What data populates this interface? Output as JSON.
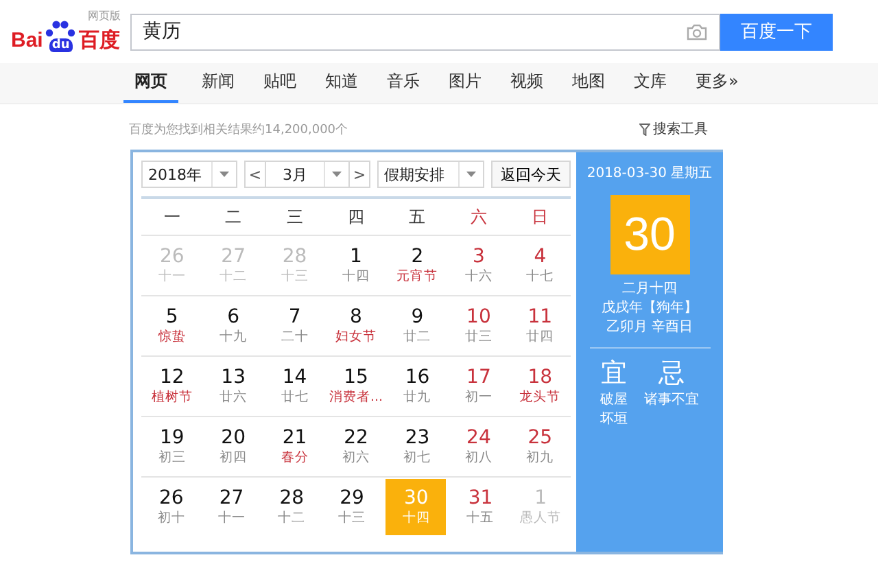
{
  "logo": {
    "left": "Bai",
    "paw": "du",
    "right": "百度",
    "sub": "网页版"
  },
  "search": {
    "value": "黄历",
    "button": "百度一下"
  },
  "tabs": [
    {
      "label": "网页",
      "selected": true
    },
    {
      "label": "新闻",
      "selected": false
    },
    {
      "label": "贴吧",
      "selected": false
    },
    {
      "label": "知道",
      "selected": false
    },
    {
      "label": "音乐",
      "selected": false
    },
    {
      "label": "图片",
      "selected": false
    },
    {
      "label": "视频",
      "selected": false
    },
    {
      "label": "地图",
      "selected": false
    },
    {
      "label": "文库",
      "selected": false
    },
    {
      "label": "更多»",
      "selected": false
    }
  ],
  "result_count": "百度为您找到相关结果约14,200,000个",
  "search_tools": "搜索工具",
  "calendar": {
    "year": "2018年",
    "month_prev": "<",
    "month": "3月",
    "month_next": ">",
    "holiday": "假期安排",
    "today_button": "返回今天",
    "weekdays": [
      {
        "label": "一",
        "weekend": false
      },
      {
        "label": "二",
        "weekend": false
      },
      {
        "label": "三",
        "weekend": false
      },
      {
        "label": "四",
        "weekend": false
      },
      {
        "label": "五",
        "weekend": false
      },
      {
        "label": "六",
        "weekend": true
      },
      {
        "label": "日",
        "weekend": true
      }
    ],
    "weeks": [
      [
        {
          "day": "26",
          "lunar": "十一",
          "kind": "other",
          "selected": false
        },
        {
          "day": "27",
          "lunar": "十二",
          "kind": "other",
          "selected": false
        },
        {
          "day": "28",
          "lunar": "十三",
          "kind": "other",
          "selected": false
        },
        {
          "day": "1",
          "lunar": "十四",
          "kind": "current",
          "weekend": false,
          "festival": false,
          "selected": false
        },
        {
          "day": "2",
          "lunar": "元宵节",
          "kind": "current",
          "weekend": false,
          "festival": true,
          "selected": false
        },
        {
          "day": "3",
          "lunar": "十六",
          "kind": "current",
          "weekend": true,
          "festival": false,
          "selected": false
        },
        {
          "day": "4",
          "lunar": "十七",
          "kind": "current",
          "weekend": true,
          "festival": false,
          "selected": false
        }
      ],
      [
        {
          "day": "5",
          "lunar": "惊蛰",
          "kind": "current",
          "weekend": false,
          "festival": true,
          "selected": false
        },
        {
          "day": "6",
          "lunar": "十九",
          "kind": "current",
          "weekend": false,
          "festival": false,
          "selected": false
        },
        {
          "day": "7",
          "lunar": "二十",
          "kind": "current",
          "weekend": false,
          "festival": false,
          "selected": false
        },
        {
          "day": "8",
          "lunar": "妇女节",
          "kind": "current",
          "weekend": false,
          "festival": true,
          "selected": false
        },
        {
          "day": "9",
          "lunar": "廿二",
          "kind": "current",
          "weekend": false,
          "festival": false,
          "selected": false
        },
        {
          "day": "10",
          "lunar": "廿三",
          "kind": "current",
          "weekend": true,
          "festival": false,
          "selected": false
        },
        {
          "day": "11",
          "lunar": "廿四",
          "kind": "current",
          "weekend": true,
          "festival": false,
          "selected": false
        }
      ],
      [
        {
          "day": "12",
          "lunar": "植树节",
          "kind": "current",
          "weekend": false,
          "festival": true,
          "selected": false
        },
        {
          "day": "13",
          "lunar": "廿六",
          "kind": "current",
          "weekend": false,
          "festival": false,
          "selected": false
        },
        {
          "day": "14",
          "lunar": "廿七",
          "kind": "current",
          "weekend": false,
          "festival": false,
          "selected": false
        },
        {
          "day": "15",
          "lunar": "消费者...",
          "kind": "current",
          "weekend": false,
          "festival": true,
          "selected": false
        },
        {
          "day": "16",
          "lunar": "廿九",
          "kind": "current",
          "weekend": false,
          "festival": false,
          "selected": false
        },
        {
          "day": "17",
          "lunar": "初一",
          "kind": "current",
          "weekend": true,
          "festival": false,
          "selected": false
        },
        {
          "day": "18",
          "lunar": "龙头节",
          "kind": "current",
          "weekend": true,
          "festival": true,
          "selected": false
        }
      ],
      [
        {
          "day": "19",
          "lunar": "初三",
          "kind": "current",
          "weekend": false,
          "festival": false,
          "selected": false
        },
        {
          "day": "20",
          "lunar": "初四",
          "kind": "current",
          "weekend": false,
          "festival": false,
          "selected": false
        },
        {
          "day": "21",
          "lunar": "春分",
          "kind": "current",
          "weekend": false,
          "festival": true,
          "selected": false
        },
        {
          "day": "22",
          "lunar": "初六",
          "kind": "current",
          "weekend": false,
          "festival": false,
          "selected": false
        },
        {
          "day": "23",
          "lunar": "初七",
          "kind": "current",
          "weekend": false,
          "festival": false,
          "selected": false
        },
        {
          "day": "24",
          "lunar": "初八",
          "kind": "current",
          "weekend": true,
          "festival": false,
          "selected": false
        },
        {
          "day": "25",
          "lunar": "初九",
          "kind": "current",
          "weekend": true,
          "festival": false,
          "selected": false
        }
      ],
      [
        {
          "day": "26",
          "lunar": "初十",
          "kind": "current",
          "weekend": false,
          "festival": false,
          "selected": false
        },
        {
          "day": "27",
          "lunar": "十一",
          "kind": "current",
          "weekend": false,
          "festival": false,
          "selected": false
        },
        {
          "day": "28",
          "lunar": "十二",
          "kind": "current",
          "weekend": false,
          "festival": false,
          "selected": false
        },
        {
          "day": "29",
          "lunar": "十三",
          "kind": "current",
          "weekend": false,
          "festival": false,
          "selected": false
        },
        {
          "day": "30",
          "lunar": "十四",
          "kind": "current",
          "weekend": false,
          "festival": false,
          "selected": true
        },
        {
          "day": "31",
          "lunar": "十五",
          "kind": "current",
          "weekend": true,
          "festival": false,
          "selected": false
        },
        {
          "day": "1",
          "lunar": "愚人节",
          "kind": "other",
          "selected": false
        }
      ]
    ]
  },
  "detail": {
    "date": "2018-03-30 星期五",
    "day": "30",
    "lunar_lines": [
      "二月十四",
      "戊戌年【狗年】",
      "乙卯月 辛酉日"
    ],
    "good": {
      "title": "宜",
      "items": [
        "破屋",
        "坏垣"
      ]
    },
    "bad": {
      "title": "忌",
      "items": [
        "诸事不宜"
      ]
    }
  }
}
